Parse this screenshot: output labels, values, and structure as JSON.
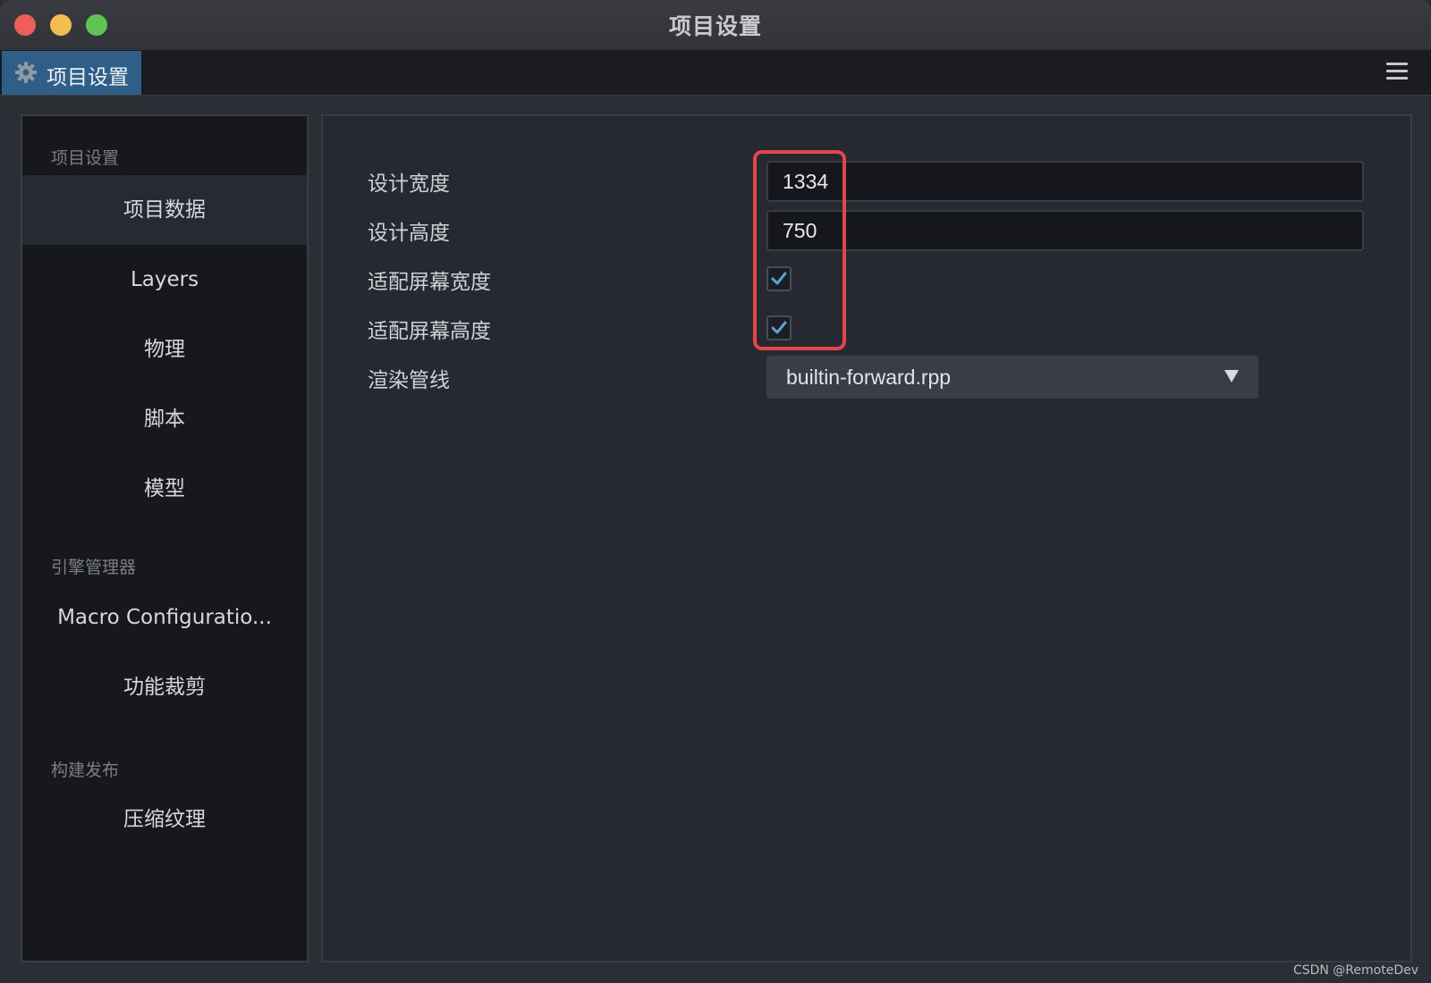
{
  "window": {
    "title": "项目设置"
  },
  "tab": {
    "label": "项目设置",
    "icon": "gear-icon"
  },
  "sidebar": {
    "sections": [
      {
        "title": "项目设置",
        "items": [
          {
            "label": "项目数据",
            "active": true
          },
          {
            "label": "Layers",
            "active": false
          },
          {
            "label": "物理",
            "active": false
          },
          {
            "label": "脚本",
            "active": false
          },
          {
            "label": "模型",
            "active": false
          }
        ]
      },
      {
        "title": "引擎管理器",
        "items": [
          {
            "label": "Macro Configuratio...",
            "active": false
          },
          {
            "label": "功能裁剪",
            "active": false
          }
        ]
      },
      {
        "title": "构建发布",
        "items": [
          {
            "label": "压缩纹理",
            "active": false
          }
        ]
      }
    ]
  },
  "properties": {
    "design_width": {
      "label": "设计宽度",
      "value": "1334"
    },
    "design_height": {
      "label": "设计高度",
      "value": "750"
    },
    "fit_width": {
      "label": "适配屏幕宽度",
      "checked": true
    },
    "fit_height": {
      "label": "适配屏幕高度",
      "checked": true
    },
    "render_pipeline": {
      "label": "渲染管线",
      "value": "builtin-forward.rpp"
    }
  },
  "watermark": "CSDN @RemoteDev",
  "colors": {
    "accent_tab": "#2f5f86",
    "checkmark": "#5aa2d6",
    "highlight": "#e2454a"
  }
}
